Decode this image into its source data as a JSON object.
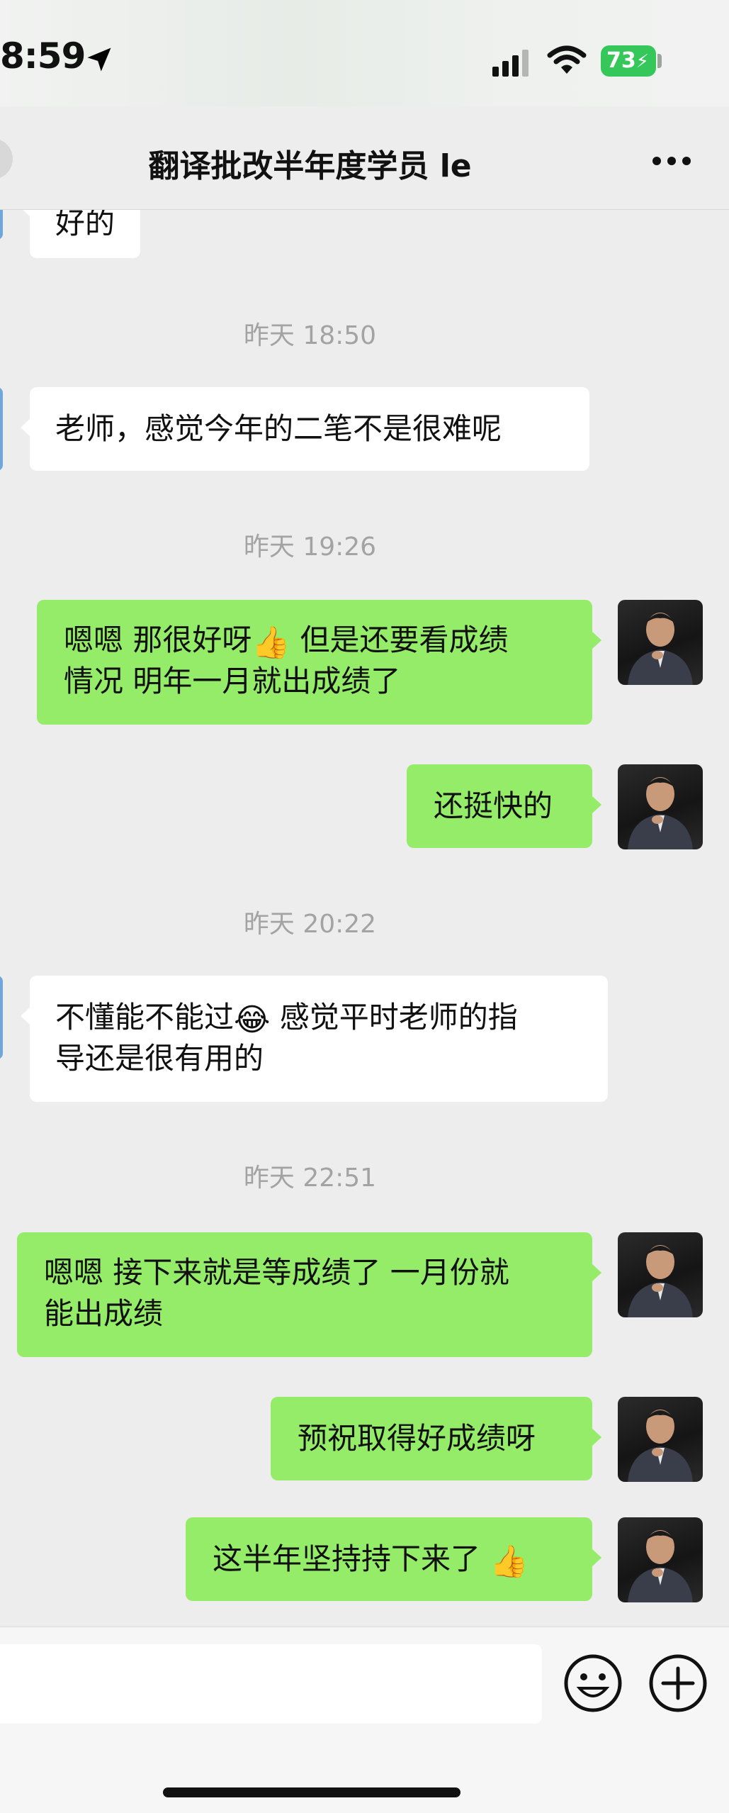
{
  "status_bar": {
    "time": "8:59",
    "battery": "73"
  },
  "header": {
    "title": "翻译批改半年度学员 le"
  },
  "messages": {
    "m0": {
      "text": "好的"
    },
    "t1": {
      "text": "昨天 18:50"
    },
    "m1": {
      "text": "老师，感觉今年的二笔不是很难呢"
    },
    "t2": {
      "text": "昨天 19:26"
    },
    "m2": {
      "l1a": "嗯嗯 那很好呀",
      "l1b": " 但是还要看成绩",
      "l2": "情况 明年一月就出成绩了"
    },
    "m3": {
      "text": "还挺快的"
    },
    "t3": {
      "text": "昨天 20:22"
    },
    "m4": {
      "l1a": "不懂能不能过",
      "l1b": " 感觉平时老师的指",
      "l2": "导还是很有用的"
    },
    "t4": {
      "text": "昨天 22:51"
    },
    "m5": {
      "l1": "嗯嗯 接下来就是等成绩了 一月份就",
      "l2": "能出成绩"
    },
    "m6": {
      "text": "预祝取得好成绩呀"
    },
    "m7": {
      "text": "这半年坚持持下来了 "
    }
  },
  "emojis": {
    "thumbs_up": "👍",
    "tears_of_joy": "😂"
  },
  "colors": {
    "outgoing_bubble": "#95ec69",
    "incoming_bubble": "#ffffff",
    "background": "#ededed",
    "timestamp": "#a3a3a3",
    "battery": "#35c759"
  },
  "icons": {
    "status": [
      "location-arrow-icon",
      "cellular-signal-icon",
      "wifi-icon",
      "battery-icon"
    ],
    "header": [
      "back-icon",
      "more-icon"
    ],
    "input": [
      "emoji-icon",
      "plus-icon"
    ]
  }
}
